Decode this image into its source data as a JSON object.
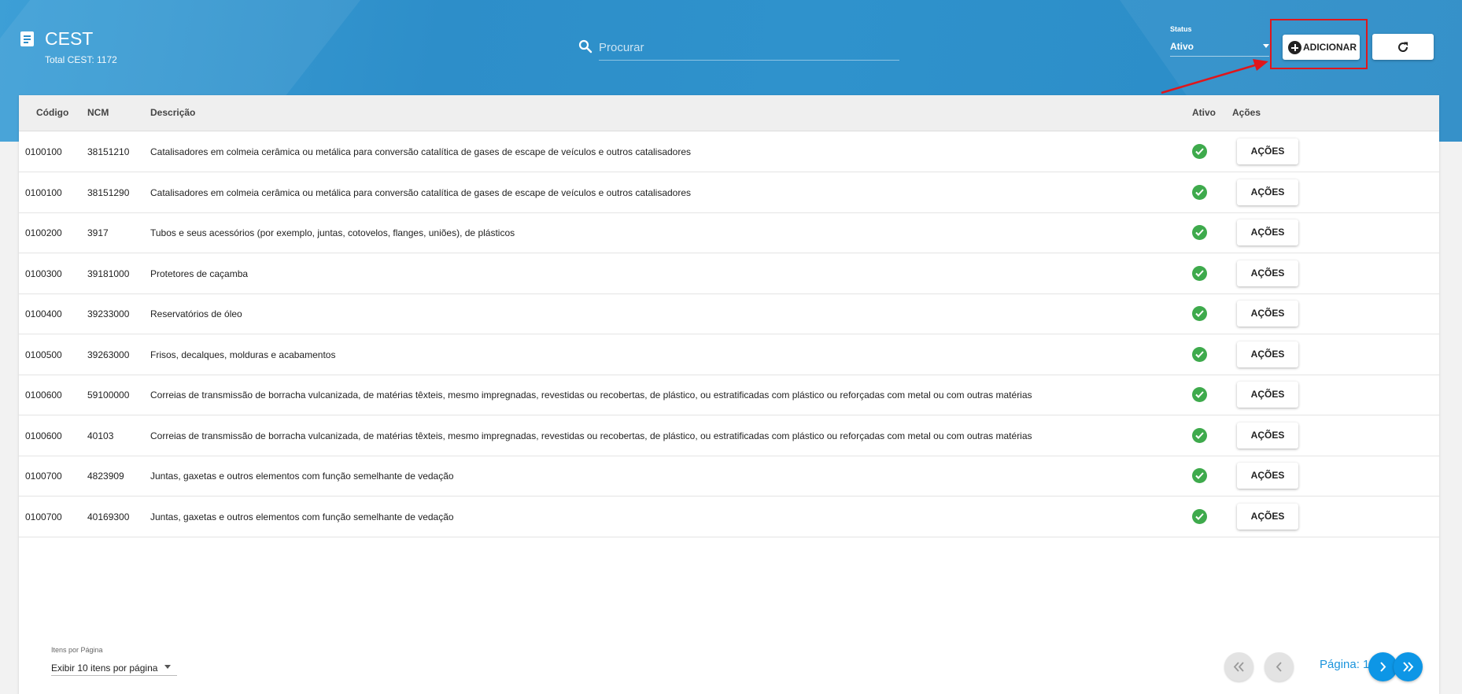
{
  "header": {
    "title": "CEST",
    "subtitle": "Total CEST: 1172",
    "icon": "document-icon"
  },
  "search": {
    "placeholder": "Procurar",
    "value": ""
  },
  "status_filter": {
    "label": "Status",
    "value": "Ativo"
  },
  "toolbar": {
    "add_label": "ADICIONAR",
    "refresh_icon": "refresh-icon",
    "highlight_color": "#e0161b"
  },
  "table": {
    "columns": [
      "Código",
      "NCM",
      "Descrição",
      "Ativo",
      "Ações"
    ],
    "action_label": "AÇÕES",
    "rows": [
      {
        "codigo": "0100100",
        "ncm": "38151210",
        "descricao": "Catalisadores em colmeia cerâmica ou metálica para conversão catalítica de gases de escape de veículos e outros catalisadores",
        "ativo": true
      },
      {
        "codigo": "0100100",
        "ncm": "38151290",
        "descricao": "Catalisadores em colmeia cerâmica ou metálica para conversão catalítica de gases de escape de veículos e outros catalisadores",
        "ativo": true
      },
      {
        "codigo": "0100200",
        "ncm": "3917",
        "descricao": "Tubos e seus acessórios (por exemplo, juntas, cotovelos, flanges, uniões), de plásticos",
        "ativo": true
      },
      {
        "codigo": "0100300",
        "ncm": "39181000",
        "descricao": "Protetores de caçamba",
        "ativo": true
      },
      {
        "codigo": "0100400",
        "ncm": "39233000",
        "descricao": "Reservatórios de óleo",
        "ativo": true
      },
      {
        "codigo": "0100500",
        "ncm": "39263000",
        "descricao": "Frisos, decalques, molduras e acabamentos",
        "ativo": true
      },
      {
        "codigo": "0100600",
        "ncm": "59100000",
        "descricao": "Correias de transmissão de borracha vulcanizada, de matérias têxteis, mesmo impregnadas, revestidas ou recobertas, de plástico, ou estratificadas com plástico ou reforçadas com metal ou com outras matérias",
        "ativo": true
      },
      {
        "codigo": "0100600",
        "ncm": "40103",
        "descricao": "Correias de transmissão de borracha vulcanizada, de matérias têxteis, mesmo impregnadas, revestidas ou recobertas, de plástico, ou estratificadas com plástico ou reforçadas com metal ou com outras matérias",
        "ativo": true
      },
      {
        "codigo": "0100700",
        "ncm": "4823909",
        "descricao": "Juntas, gaxetas e outros elementos com função semelhante de vedação",
        "ativo": true
      },
      {
        "codigo": "0100700",
        "ncm": "40169300",
        "descricao": "Juntas, gaxetas e outros elementos com função semelhante de vedação",
        "ativo": true
      }
    ]
  },
  "pagination": {
    "per_page_label": "Itens por Página",
    "per_page_value": "Exibir 10 itens por página",
    "page_label": "Página: 1",
    "active_color": "#0d96e6"
  }
}
